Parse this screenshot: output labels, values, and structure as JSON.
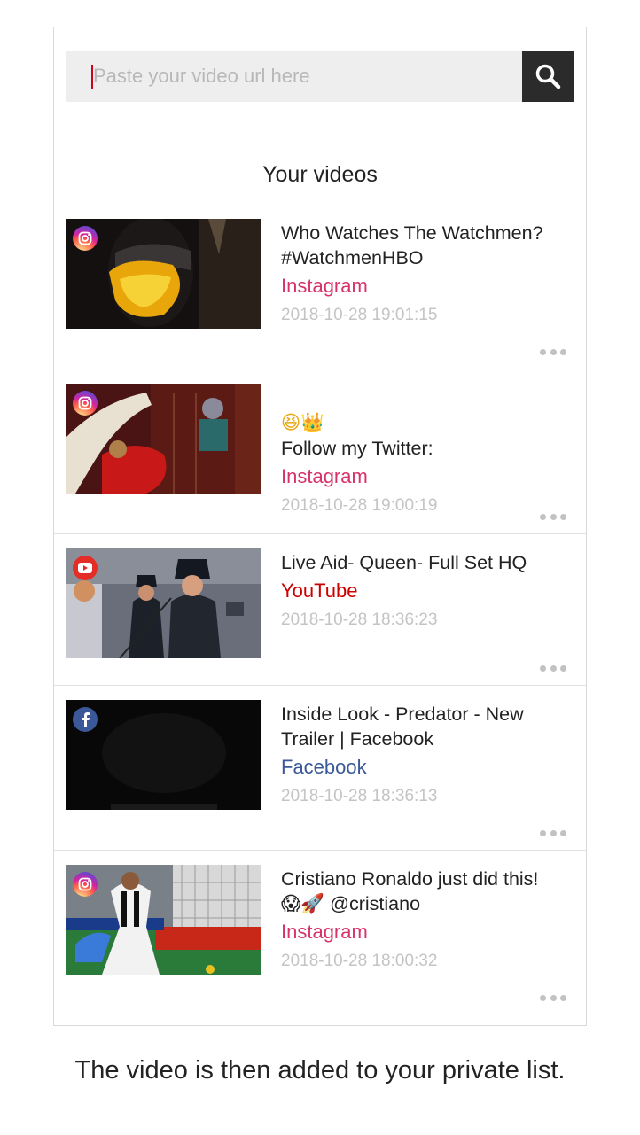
{
  "search": {
    "placeholder": "Paste your video url here",
    "value": ""
  },
  "section_title": "Your videos",
  "videos": [
    {
      "title": "Who Watches The Watchmen?\n#WatchmenHBO",
      "source": "Instagram",
      "timestamp": "2018-10-28 19:01:15",
      "badge_icon": "instagram-icon"
    },
    {
      "title": "Follow my Twitter:",
      "title_emoji": "😆👑",
      "source": "Instagram",
      "timestamp": "2018-10-28 19:00:19",
      "badge_icon": "instagram-icon"
    },
    {
      "title": "Live Aid- Queen- Full Set HQ",
      "source": "YouTube",
      "timestamp": "2018-10-28 18:36:23",
      "badge_icon": "youtube-icon"
    },
    {
      "title": "Inside Look - Predator - New\nTrailer | Facebook",
      "source": "Facebook",
      "timestamp": "2018-10-28 18:36:13",
      "badge_icon": "facebook-icon"
    },
    {
      "title": "Cristiano Ronaldo just did this!\n😱🚀 @cristiano",
      "source": "Instagram",
      "timestamp": "2018-10-28 18:00:32",
      "badge_icon": "instagram-icon"
    }
  ],
  "caption": "The video is then added to your private list.",
  "colors": {
    "instagram": "#d6336c",
    "youtube": "#cc0000",
    "facebook": "#3b5998",
    "search_button": "#2b2b2b"
  }
}
